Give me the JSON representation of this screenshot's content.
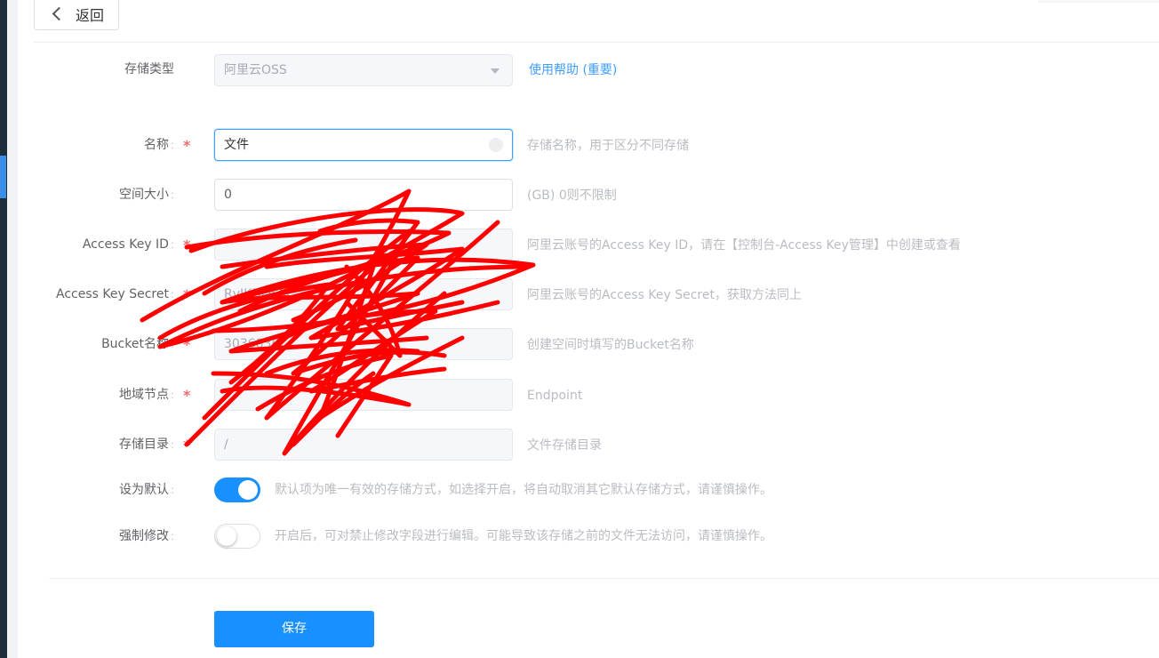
{
  "nav": {
    "back_label": "返回"
  },
  "form": {
    "storage_type": {
      "label": "存储类型",
      "value": "阿里云OSS",
      "help_link": "使用帮助 (重要)"
    },
    "name": {
      "label": "名称",
      "value": "文件",
      "hint": "存储名称，用于区分不同存储",
      "required": true
    },
    "space_size": {
      "label": "空间大小",
      "value": "0",
      "hint": "(GB) 0则不限制"
    },
    "access_key_id": {
      "label": "Access Key ID",
      "value": "",
      "hint": "阿里云账号的Access Key ID，请在【控制台-Access Key管理】中创建或查看",
      "required": true
    },
    "access_key_secret": {
      "label": "Access Key Secret",
      "value": "RvIKDOSM",
      "hint": "阿里云账号的Access Key Secret，获取方法同上",
      "required": true
    },
    "bucket_name": {
      "label": "Bucket名称",
      "value": "3036836",
      "hint": "创建空间时填写的Bucket名称",
      "required": true
    },
    "region_endpoint": {
      "label": "地域节点",
      "value": "",
      "hint": "Endpoint",
      "required": true
    },
    "storage_dir": {
      "label": "存储目录",
      "value": "/",
      "hint": "文件存储目录",
      "required": true
    },
    "set_default": {
      "label": "设为默认",
      "enabled": true,
      "hint": "默认项为唯一有效的存储方式，如选择开启，将自动取消其它默认存储方式，请谨慎操作。"
    },
    "force_modify": {
      "label": "强制修改",
      "enabled": false,
      "hint": "开启后，可对禁止修改字段进行编辑。可能导致该存储之前的文件无法访问，请谨慎操作。"
    },
    "colon": ":",
    "required_mark": "*"
  },
  "actions": {
    "save_label": "保存"
  },
  "colors": {
    "primary": "#1890ff",
    "link": "#409eff",
    "required": "#f56c6c",
    "redaction": "#ff0000"
  }
}
